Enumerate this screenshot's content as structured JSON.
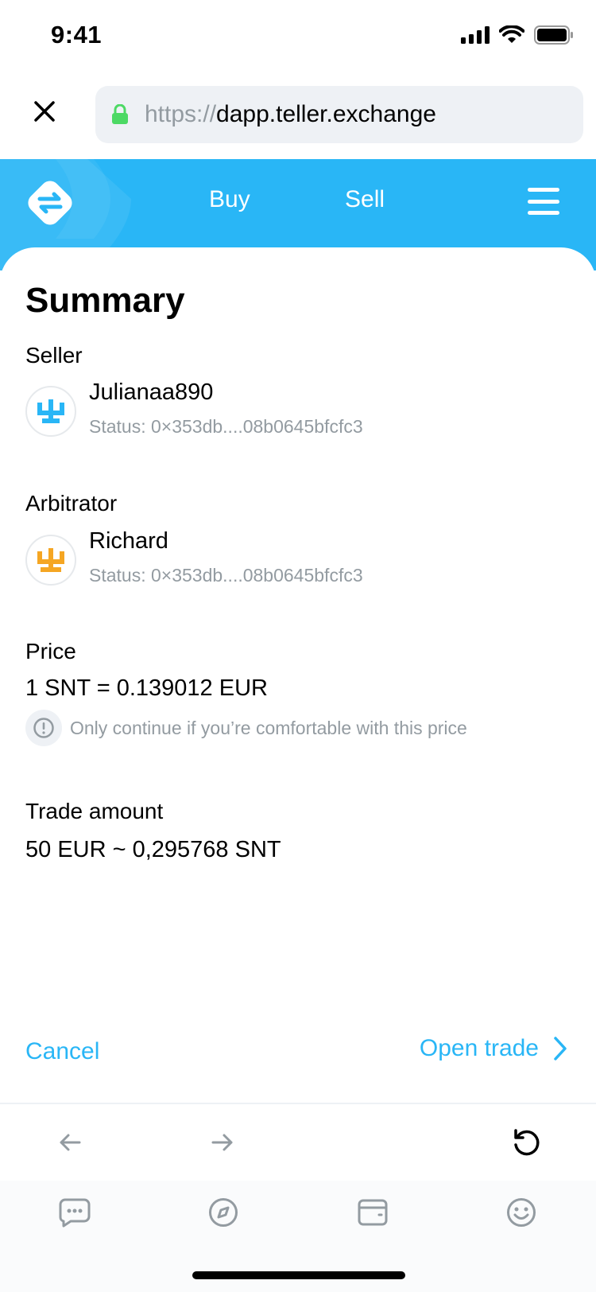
{
  "status_bar": {
    "time": "9:41"
  },
  "browser": {
    "url_scheme": "https://",
    "url_host": "dapp.teller.exchange",
    "icons": {
      "close": "close-icon",
      "lock": "lock-icon"
    }
  },
  "dapp_header": {
    "nav": {
      "buy": "Buy",
      "sell": "Sell"
    },
    "icons": {
      "logo": "teller-logo-icon",
      "menu": "hamburger-menu-icon"
    }
  },
  "summary": {
    "title": "Summary",
    "seller": {
      "label": "Seller",
      "name": "Julianaa890",
      "status": "Status: 0×353db....08b0645bfcfc3",
      "avatar_color": "#29b6f6"
    },
    "arbitrator": {
      "label": "Arbitrator",
      "name": "Richard",
      "status": "Status: 0×353db....08b0645bfcfc3",
      "avatar_color": "#f5a623"
    },
    "price": {
      "label": "Price",
      "value": "1 SNT = 0.139012 EUR",
      "warning": "Only continue if you’re comfortable with this price"
    },
    "trade_amount": {
      "label": "Trade amount",
      "value": "50 EUR ~ 0,295768 SNT"
    },
    "actions": {
      "cancel": "Cancel",
      "open_trade": "Open trade"
    }
  },
  "browser_toolbar": {
    "icons": [
      "back-arrow-icon",
      "forward-arrow-icon",
      "reload-icon"
    ]
  },
  "tab_bar": {
    "icons": [
      "chat-icon",
      "compass-icon",
      "wallet-icon",
      "profile-icon"
    ]
  },
  "colors": {
    "accent": "#29b6f6",
    "muted": "#939ba1",
    "field_bg": "#eef1f5"
  }
}
